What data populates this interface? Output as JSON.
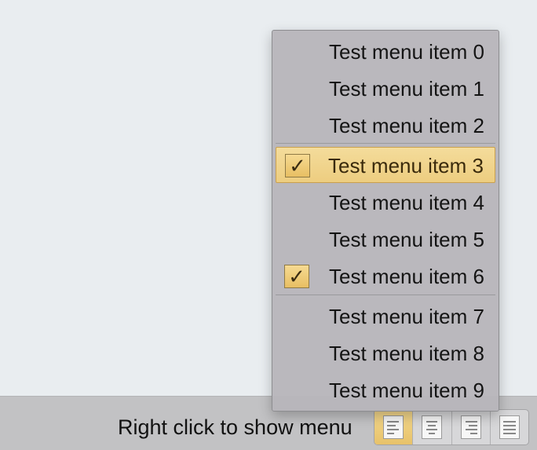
{
  "menu": {
    "items": [
      {
        "label": "Test menu item 0",
        "checked": false,
        "highlighted": false
      },
      {
        "label": "Test menu item 1",
        "checked": false,
        "highlighted": false
      },
      {
        "label": "Test menu item 2",
        "checked": false,
        "highlighted": false
      },
      {
        "label": "Test menu item 3",
        "checked": true,
        "highlighted": true
      },
      {
        "label": "Test menu item 4",
        "checked": false,
        "highlighted": false
      },
      {
        "label": "Test menu item 5",
        "checked": false,
        "highlighted": false
      },
      {
        "label": "Test menu item 6",
        "checked": true,
        "highlighted": false
      },
      {
        "label": "Test menu item 7",
        "checked": false,
        "highlighted": false
      },
      {
        "label": "Test menu item 8",
        "checked": false,
        "highlighted": false
      },
      {
        "label": "Test menu item 9",
        "checked": false,
        "highlighted": false
      }
    ],
    "check_glyph": "✓"
  },
  "bottom_bar": {
    "hint": "Right click to show menu",
    "alignment_buttons": [
      {
        "icon": "align-left-icon",
        "selected": true
      },
      {
        "icon": "align-center-icon",
        "selected": false
      },
      {
        "icon": "align-right-icon",
        "selected": false
      },
      {
        "icon": "align-justify-icon",
        "selected": false
      }
    ]
  },
  "colors": {
    "background": "#e9edf0",
    "menu_background": "#b8b6bb",
    "highlight": "#f4dc9b",
    "checkbox": "#e8bf63"
  }
}
